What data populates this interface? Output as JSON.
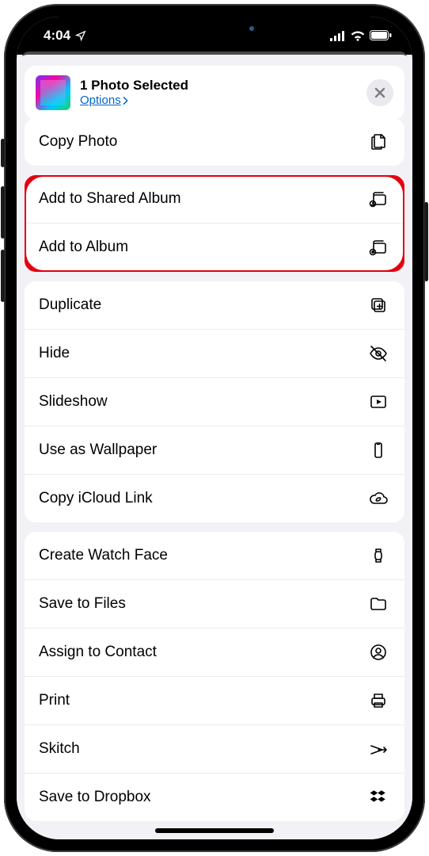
{
  "status": {
    "time": "4:04"
  },
  "header": {
    "title": "1 Photo Selected",
    "options": "Options"
  },
  "groups": [
    {
      "rows": [
        {
          "id": "copy-photo",
          "label": "Copy Photo",
          "icon": "copy"
        }
      ]
    },
    {
      "annot": true,
      "rows": [
        {
          "id": "add-shared-album",
          "label": "Add to Shared Album",
          "icon": "shared-album"
        },
        {
          "id": "add-album",
          "label": "Add to Album",
          "icon": "add-album"
        }
      ]
    },
    {
      "rows": [
        {
          "id": "duplicate",
          "label": "Duplicate",
          "icon": "duplicate"
        },
        {
          "id": "hide",
          "label": "Hide",
          "icon": "eye-off"
        },
        {
          "id": "slideshow",
          "label": "Slideshow",
          "icon": "play"
        },
        {
          "id": "wallpaper",
          "label": "Use as Wallpaper",
          "icon": "phone"
        },
        {
          "id": "icloud-link",
          "label": "Copy iCloud Link",
          "icon": "cloud-link"
        }
      ]
    },
    {
      "rows": [
        {
          "id": "watch-face",
          "label": "Create Watch Face",
          "icon": "watch"
        },
        {
          "id": "save-files",
          "label": "Save to Files",
          "icon": "folder"
        },
        {
          "id": "assign-contact",
          "label": "Assign to Contact",
          "icon": "contact"
        },
        {
          "id": "print",
          "label": "Print",
          "icon": "printer"
        },
        {
          "id": "skitch",
          "label": "Skitch",
          "icon": "skitch"
        },
        {
          "id": "dropbox",
          "label": "Save to Dropbox",
          "icon": "dropbox"
        }
      ]
    }
  ]
}
